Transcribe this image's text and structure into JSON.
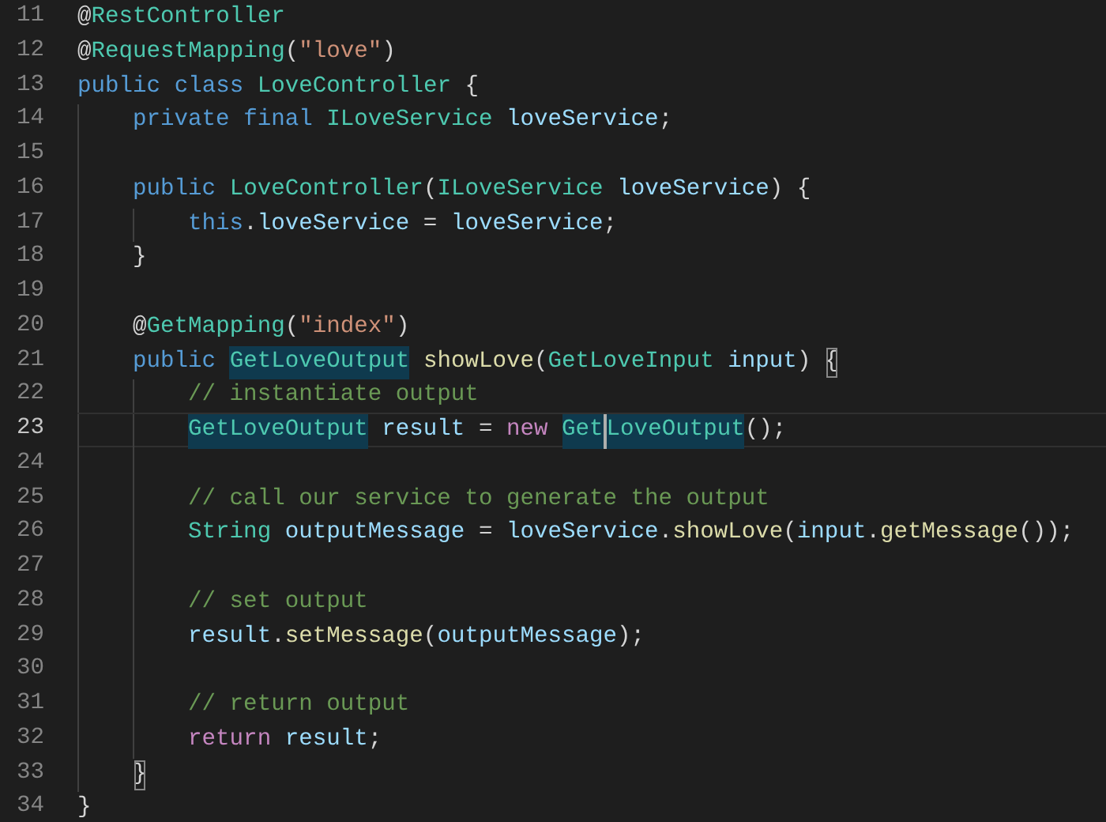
{
  "editor": {
    "lines": [
      {
        "number": "11",
        "current": false,
        "tokens": [
          {
            "text": "@",
            "kind": "plain"
          },
          {
            "text": "RestController",
            "kind": "type"
          }
        ]
      },
      {
        "number": "12",
        "current": false,
        "tokens": [
          {
            "text": "@",
            "kind": "plain"
          },
          {
            "text": "RequestMapping",
            "kind": "type"
          },
          {
            "text": "(",
            "kind": "plain"
          },
          {
            "text": "\"love\"",
            "kind": "string"
          },
          {
            "text": ")",
            "kind": "plain"
          }
        ]
      },
      {
        "number": "13",
        "current": false,
        "tokens": [
          {
            "text": "public ",
            "kind": "keyword"
          },
          {
            "text": "class ",
            "kind": "keyword"
          },
          {
            "text": "LoveController",
            "kind": "type"
          },
          {
            "text": " {",
            "kind": "plain"
          }
        ],
        "children": [
          {
            "number": "14",
            "current": false,
            "tokens": [
              {
                "text": "private ",
                "kind": "keyword"
              },
              {
                "text": "final ",
                "kind": "keyword"
              },
              {
                "text": "ILoveService ",
                "kind": "type"
              },
              {
                "text": "loveService",
                "kind": "variable"
              },
              {
                "text": ";",
                "kind": "plain"
              }
            ]
          },
          {
            "number": "15",
            "current": false
          },
          {
            "number": "16",
            "current": false,
            "tokens": [
              {
                "text": "public ",
                "kind": "keyword"
              },
              {
                "text": "LoveController",
                "kind": "type"
              },
              {
                "text": "(",
                "kind": "plain"
              },
              {
                "text": "ILoveService ",
                "kind": "type"
              },
              {
                "text": "loveService",
                "kind": "variable"
              },
              {
                "text": ") {",
                "kind": "plain"
              }
            ],
            "children": [
              {
                "number": "17",
                "current": false,
                "tokens": [
                  {
                    "text": "this",
                    "kind": "keyword"
                  },
                  {
                    "text": ".",
                    "kind": "plain"
                  },
                  {
                    "text": "loveService",
                    "kind": "variable"
                  },
                  {
                    "text": " = ",
                    "kind": "plain"
                  },
                  {
                    "text": "loveService",
                    "kind": "variable"
                  },
                  {
                    "text": ";",
                    "kind": "plain"
                  }
                ]
              }
            ]
          },
          {
            "number": "18",
            "current": false,
            "tokens": [
              {
                "text": "}",
                "kind": "plain"
              }
            ]
          },
          {
            "number": "19",
            "current": false
          },
          {
            "number": "20",
            "current": false,
            "tokens": [
              {
                "text": "@",
                "kind": "plain"
              },
              {
                "text": "GetMapping",
                "kind": "type"
              },
              {
                "text": "(",
                "kind": "plain"
              },
              {
                "text": "\"index\"",
                "kind": "string"
              },
              {
                "text": ")",
                "kind": "plain"
              }
            ]
          },
          {
            "number": "21",
            "current": false,
            "tokens": [
              {
                "text": "public ",
                "kind": "keyword"
              },
              {
                "text": "GetLoveOutput",
                "kind": "type_match"
              },
              {
                "text": " showLove",
                "kind": "function"
              },
              {
                "text": "(",
                "kind": "plain"
              },
              {
                "text": "GetLoveInput ",
                "kind": "type"
              },
              {
                "text": "input",
                "kind": "variable"
              },
              {
                "text": ") ",
                "kind": "plain"
              },
              {
                "text": "{",
                "kind": "bracket_match"
              }
            ],
            "children": [
              {
                "number": "22",
                "current": false,
                "tokens": [
                  {
                    "text": "// instantiate output",
                    "kind": "comment"
                  }
                ]
              },
              {
                "number": "23",
                "current": true,
                "tokens": [
                  {
                    "text": "GetLoveOutput",
                    "kind": "type_match"
                  },
                  {
                    "text": " result",
                    "kind": "variable"
                  },
                  {
                    "text": " = ",
                    "kind": "plain"
                  },
                  {
                    "text": "new ",
                    "kind": "control"
                  },
                  {
                    "text": "Get",
                    "kind": "type_match_caret"
                  },
                  {
                    "text": "LoveOutput",
                    "kind": "type_match"
                  },
                  {
                    "text": "();",
                    "kind": "plain"
                  }
                ]
              },
              {
                "number": "24",
                "current": false
              },
              {
                "number": "25",
                "current": false,
                "tokens": [
                  {
                    "text": "// call our service to generate the output",
                    "kind": "comment"
                  }
                ]
              },
              {
                "number": "26",
                "current": false,
                "tokens": [
                  {
                    "text": "String ",
                    "kind": "type"
                  },
                  {
                    "text": "outputMessage",
                    "kind": "variable"
                  },
                  {
                    "text": " = ",
                    "kind": "plain"
                  },
                  {
                    "text": "loveService",
                    "kind": "variable"
                  },
                  {
                    "text": ".",
                    "kind": "plain"
                  },
                  {
                    "text": "showLove",
                    "kind": "function"
                  },
                  {
                    "text": "(",
                    "kind": "plain"
                  },
                  {
                    "text": "input",
                    "kind": "variable"
                  },
                  {
                    "text": ".",
                    "kind": "plain"
                  },
                  {
                    "text": "getMessage",
                    "kind": "function"
                  },
                  {
                    "text": "());",
                    "kind": "plain"
                  }
                ]
              },
              {
                "number": "27",
                "current": false
              },
              {
                "number": "28",
                "current": false,
                "tokens": [
                  {
                    "text": "// set output",
                    "kind": "comment"
                  }
                ]
              },
              {
                "number": "29",
                "current": false,
                "tokens": [
                  {
                    "text": "result",
                    "kind": "variable"
                  },
                  {
                    "text": ".",
                    "kind": "plain"
                  },
                  {
                    "text": "setMessage",
                    "kind": "function"
                  },
                  {
                    "text": "(",
                    "kind": "plain"
                  },
                  {
                    "text": "outputMessage",
                    "kind": "variable"
                  },
                  {
                    "text": ");",
                    "kind": "plain"
                  }
                ]
              },
              {
                "number": "30",
                "current": false
              },
              {
                "number": "31",
                "current": false,
                "tokens": [
                  {
                    "text": "// return output",
                    "kind": "comment"
                  }
                ]
              },
              {
                "number": "32",
                "current": false,
                "tokens": [
                  {
                    "text": "return ",
                    "kind": "control"
                  },
                  {
                    "text": "result",
                    "kind": "variable"
                  },
                  {
                    "text": ";",
                    "kind": "plain"
                  }
                ]
              }
            ]
          },
          {
            "number": "33",
            "current": false,
            "tokens": [
              {
                "text": "}",
                "kind": "bracket_match"
              }
            ]
          }
        ]
      },
      {
        "number": "34",
        "current": false,
        "tokens": [
          {
            "text": "}",
            "kind": "plain"
          }
        ]
      }
    ]
  }
}
